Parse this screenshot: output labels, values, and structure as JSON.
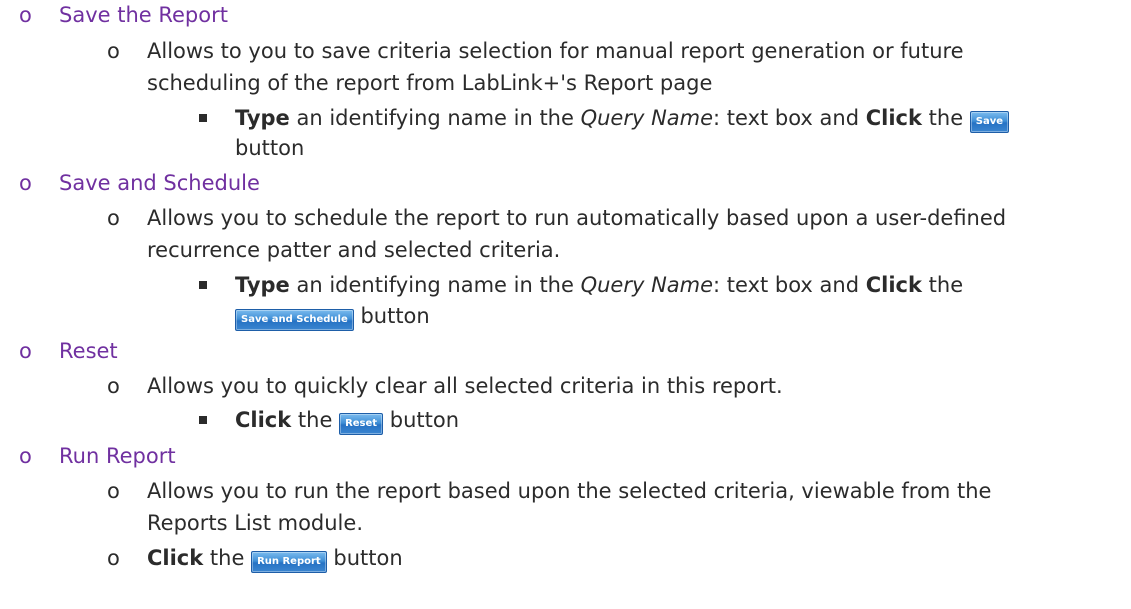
{
  "sections": [
    {
      "heading": "Save the Report",
      "desc_line1": "Allows to you to save criteria selection for manual report generation or future",
      "desc_line2": "scheduling of the report from LabLink+'s Report page",
      "step_bold": "Type",
      "step_mid1": " an identifying name in the ",
      "step_italic": "Query Name",
      "step_mid2": ": text box and ",
      "step_bold2": "Click",
      "step_mid3": " the ",
      "button_label": "Save",
      "step_tail": "button"
    },
    {
      "heading": "Save and Schedule",
      "desc_line1": "Allows you to schedule the report to run automatically based upon a user-defined",
      "desc_line2": "recurrence patter and selected criteria.",
      "step_bold": "Type",
      "step_mid1": " an identifying name in the ",
      "step_italic": "Query Name",
      "step_mid2": ": text box and ",
      "step_bold2": "Click",
      "step_mid3": " the",
      "button_label": "Save and Schedule",
      "step_tail": " button"
    },
    {
      "heading": "Reset",
      "desc_line1": "Allows you to quickly clear all selected criteria in this report.",
      "step_bold": "Click",
      "step_mid": " the ",
      "button_label": "Reset",
      "step_tail": " button"
    },
    {
      "heading": "Run Report",
      "desc_line1": "Allows you to run the report based upon the selected criteria, viewable from the",
      "desc_line2": "Reports List module.",
      "step_bold": "Click",
      "step_mid": " the ",
      "button_label": "Run Report",
      "step_tail": " button"
    }
  ],
  "bullet_glyph": "o",
  "colors": {
    "heading": "#7030a0",
    "text": "#2b2b2b",
    "button": "#3b86d0"
  }
}
